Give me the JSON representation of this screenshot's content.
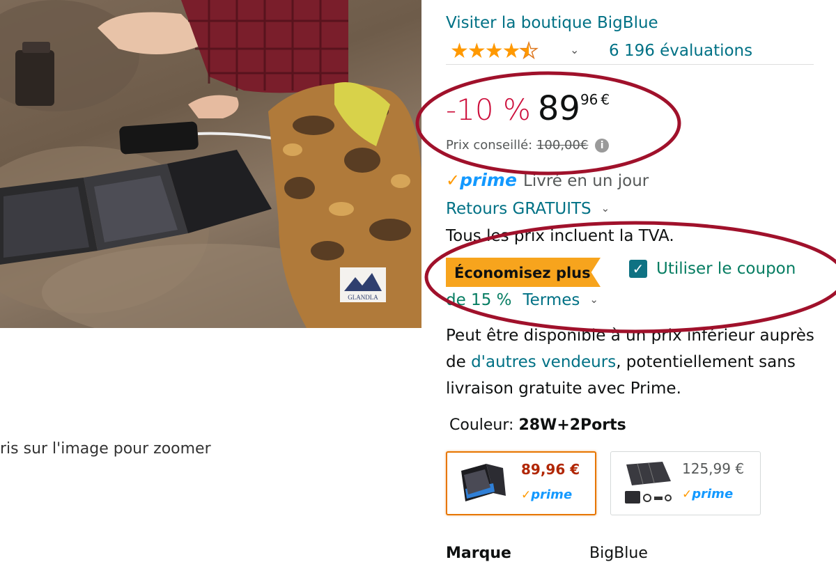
{
  "image": {
    "zoom_hint": "ris sur l'image pour zoomer",
    "logo_text": "GLANDLA"
  },
  "store": {
    "link_label": "Visiter la boutique BigBlue"
  },
  "rating": {
    "stars": 4.5,
    "review_count_label": "6 196 évaluations"
  },
  "price": {
    "discount": "-10 %",
    "whole": "89",
    "fraction": "96",
    "currency": "€",
    "list_label": "Prix conseillé:",
    "list_value": "100,00€"
  },
  "delivery": {
    "prime_check": "✓",
    "prime_label": "prime",
    "text": "Livré en un jour",
    "returns_label": "Retours GRATUITS"
  },
  "tax_note": "Tous les prix incluent la TVA.",
  "coupon": {
    "badge": "Économisez plus",
    "checkbox_label": "Utiliser le coupon",
    "amount": "de 15 %",
    "terms_label": "Termes"
  },
  "other_sellers": {
    "prefix": "Peut être disponible à un prix inférieur auprès de ",
    "link": "d'autres vendeurs",
    "suffix": ", potentiellement sans livraison gratuite avec Prime."
  },
  "variant": {
    "color_label": "Couleur:",
    "color_value": "28W+2Ports",
    "options": [
      {
        "price": "89,96 €",
        "prime_label": "prime",
        "selected": true
      },
      {
        "price": "125,99 €",
        "prime_label": "prime",
        "selected": false
      }
    ]
  },
  "details": {
    "brand_label": "Marque",
    "brand_value": "BigBlue"
  },
  "colors": {
    "link": "#007185",
    "discount_red": "#cc0c39",
    "coupon_orange": "#f7a41d",
    "prime_blue": "#1399ff",
    "annotation_red": "#a0112b"
  }
}
